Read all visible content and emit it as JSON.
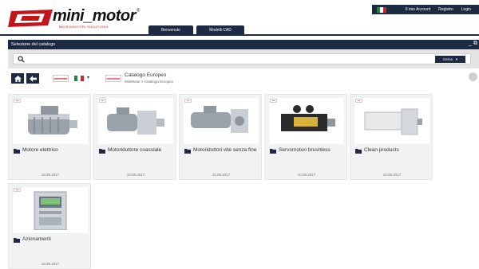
{
  "brand": {
    "name": "mini_motor",
    "tagline": "MICROMOTORI SOLUTIONS",
    "registered": "®",
    "red": "#c3141b"
  },
  "nav": {
    "tabs": [
      "Benvenuto",
      "Modelli CAD"
    ]
  },
  "top_links": [
    "Il mio Account",
    "Registro",
    "Login"
  ],
  "colors": {
    "navy": "#1c2a44",
    "panel_gray": "#e3e3e3",
    "card_gray": "#f2f2f2"
  },
  "panel": {
    "title": "Selezione del catalogo",
    "window_controls": "_ ⧉"
  },
  "search": {
    "value": "",
    "placeholder": "",
    "button_label": "Cerca",
    "button_caret": "▾"
  },
  "toolbar": {
    "lang_caret": "▾",
    "catalog_title": "Catalogo Europeo",
    "breadcrumb": "MiniMotor  >  Catalogo Europeo",
    "mini_logo_text": "minimotor"
  },
  "items": [
    {
      "label": "Motore elettrico",
      "date": "10.08.2017",
      "icon": "electric-motor"
    },
    {
      "label": "Motoriduttore coassiale",
      "date": "10.08.2017",
      "icon": "coaxial-gearmotor"
    },
    {
      "label": "Motoriduttori vite senza fine",
      "date": "10.08.2017",
      "icon": "worm-gearmotor"
    },
    {
      "label": "Servomotori brushless",
      "date": "10.08.2017",
      "icon": "brushless-servomotor"
    },
    {
      "label": "Clean products",
      "date": "10.08.2017",
      "icon": "clean-product"
    },
    {
      "label": "Azionamenti",
      "date": "10.08.2017",
      "icon": "drive-controller"
    }
  ]
}
